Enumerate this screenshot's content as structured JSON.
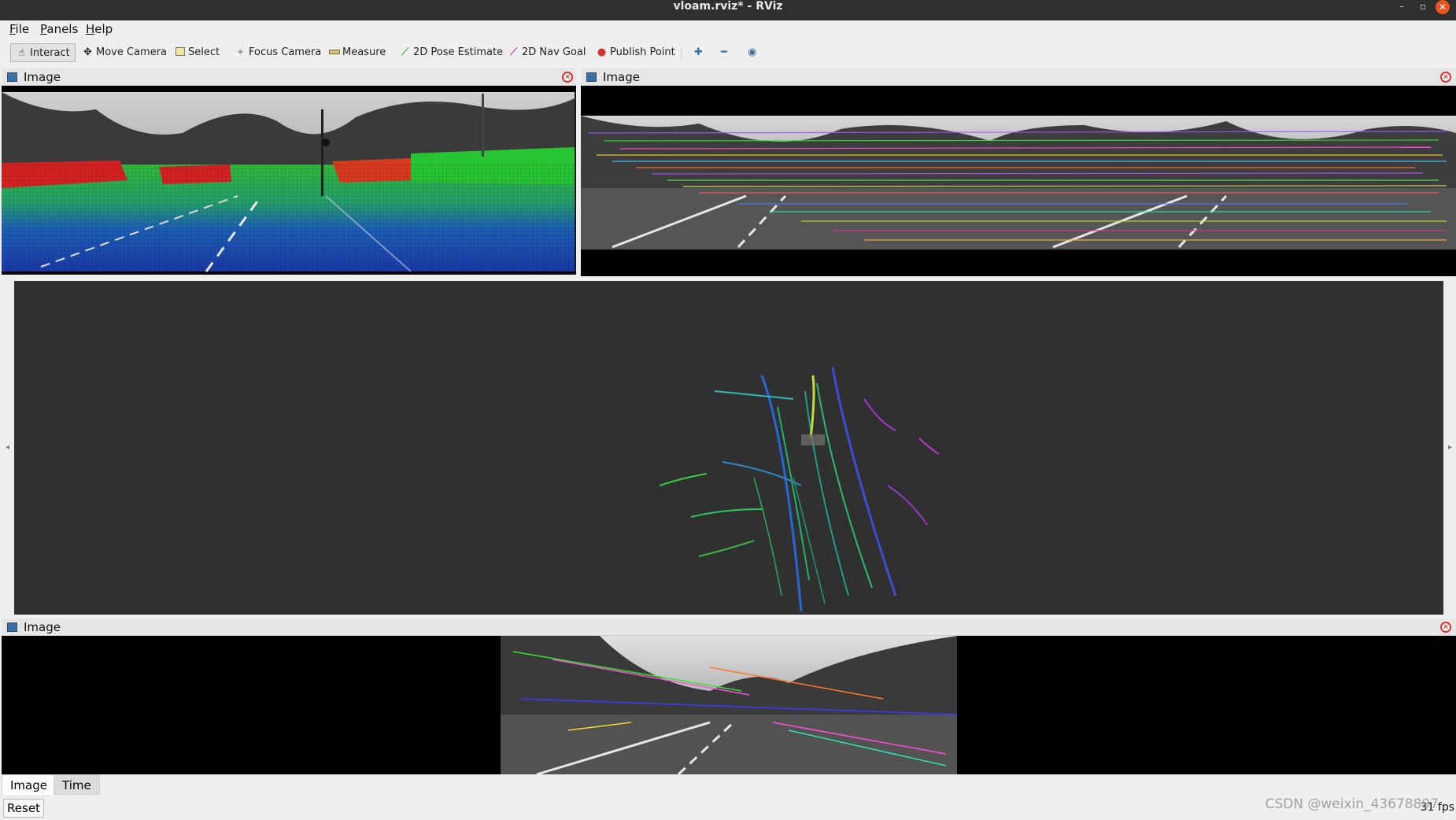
{
  "window": {
    "title": "vloam.rviz* - RViz",
    "minimize": "–",
    "restore": "▫",
    "close": "✕"
  },
  "menu": {
    "file": "File",
    "panels": "Panels",
    "help": "Help"
  },
  "toolbar": {
    "interact": "Interact",
    "move_camera": "Move Camera",
    "select": "Select",
    "focus_camera": "Focus Camera",
    "measure": "Measure",
    "pose_estimate": "2D Pose Estimate",
    "nav_goal": "2D Nav Goal",
    "publish_point": "Publish Point",
    "colors": {
      "pose_estimate": "#2fbf2f",
      "nav_goal": "#d52fd5",
      "publish_point": "#d8342b"
    }
  },
  "panels": {
    "top_left": {
      "title": "Image"
    },
    "top_right": {
      "title": "Image"
    },
    "bottom": {
      "title": "Image"
    }
  },
  "bottom_tabs": {
    "image": "Image",
    "time": "Time"
  },
  "status": {
    "reset": "Reset",
    "fps": "31 fps"
  },
  "watermark": "CSDN @weixin_43678897"
}
